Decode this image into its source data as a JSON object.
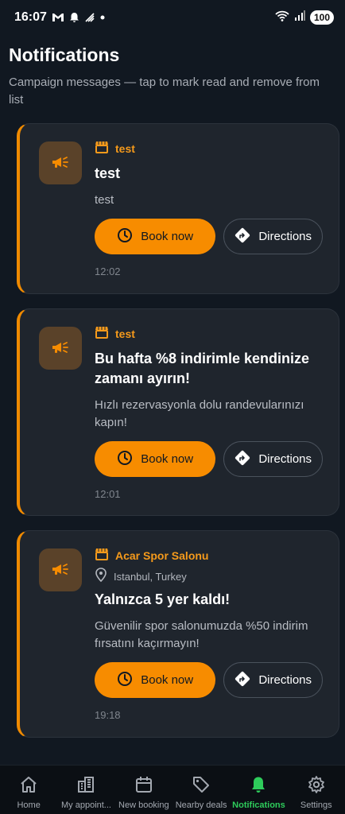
{
  "status_bar": {
    "time": "16:07",
    "battery": "100"
  },
  "header": {
    "title": "Notifications",
    "subtitle": "Campaign messages — tap to mark read and remove from list"
  },
  "notifications": [
    {
      "business": "test",
      "location": "",
      "title": "test",
      "message": "test",
      "book_label": "Book now",
      "directions_label": "Directions",
      "time": "12:02"
    },
    {
      "business": "test",
      "location": "",
      "title": "Bu hafta %8 indirimle kendinize zamanı ayırın!",
      "message": "Hızlı rezervasyonla dolu randevularınızı kapın!",
      "book_label": "Book now",
      "directions_label": "Directions",
      "time": "12:01"
    },
    {
      "business": "Acar Spor Salonu",
      "location": "Istanbul, Turkey",
      "title": "Yalnızca 5 yer kaldı!",
      "message": "Güvenilir spor salonumuzda %50 indirim fırsatını kaçırmayın!",
      "book_label": "Book now",
      "directions_label": "Directions",
      "time": "19:18"
    }
  ],
  "bottom_nav": {
    "items": [
      {
        "label": "Home",
        "icon": "home-icon"
      },
      {
        "label": "My appoint...",
        "icon": "building-icon"
      },
      {
        "label": "New booking",
        "icon": "calendar-icon"
      },
      {
        "label": "Nearby deals",
        "icon": "tag-icon"
      },
      {
        "label": "Notifications",
        "icon": "bell-icon",
        "active": true
      },
      {
        "label": "Settings",
        "icon": "gear-icon"
      }
    ]
  },
  "colors": {
    "background": "#111821",
    "card": "#1f252d",
    "accent": "#f78c00",
    "active_nav": "#2ecc5b"
  }
}
